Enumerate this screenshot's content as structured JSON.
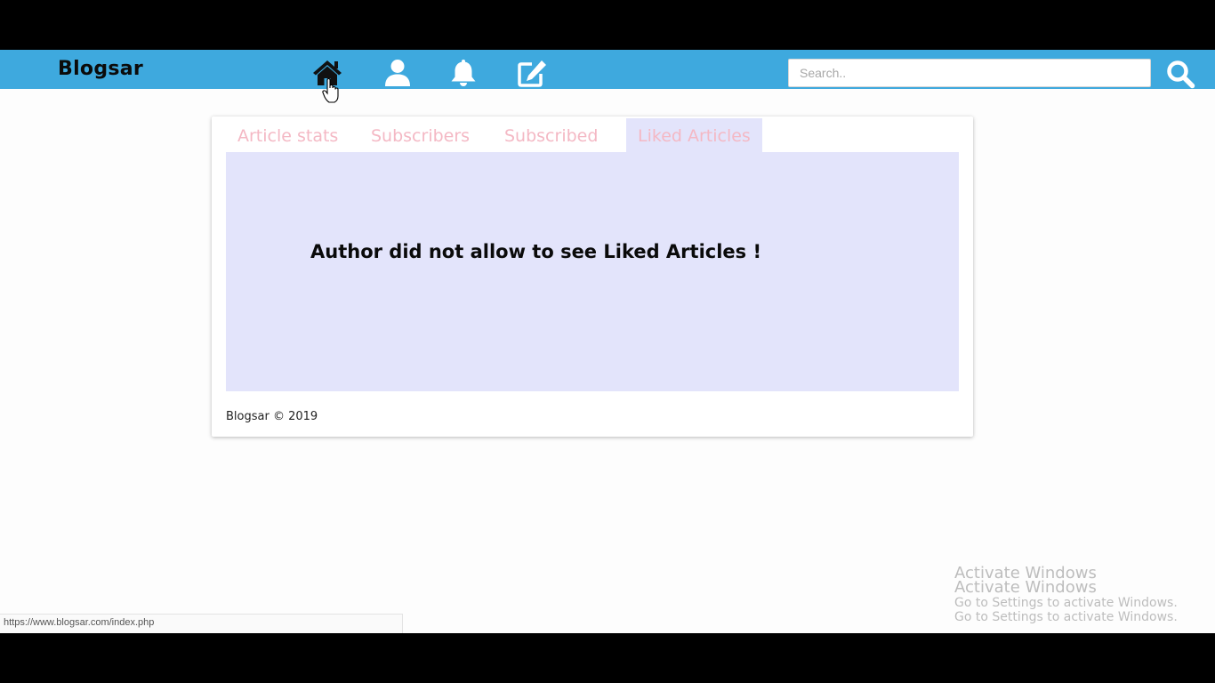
{
  "navbar": {
    "brand": "Blogsar",
    "icons": [
      "home-icon",
      "user-icon",
      "bell-icon",
      "edit-icon"
    ],
    "search": {
      "placeholder": "Search..",
      "value": ""
    },
    "search_icon": "search-icon",
    "color": "#3ea9de"
  },
  "tabs": [
    {
      "label": "Article stats",
      "active": false
    },
    {
      "label": "Subscribers",
      "active": false
    },
    {
      "label": "Subscribed",
      "active": false
    },
    {
      "label": "Liked Articles",
      "active": true
    }
  ],
  "panel": {
    "message": "Author did not allow to see Liked Articles !"
  },
  "footer": {
    "text": "Blogsar © 2019"
  },
  "watermark": {
    "title": "Activate Windows",
    "subtitle": "Go to Settings to activate Windows."
  },
  "status_bar": {
    "url": "https://www.blogsar.com/index.php"
  },
  "colors": {
    "tab_text": "#f4b8c4",
    "panel_bg": "#e3e4fb"
  }
}
